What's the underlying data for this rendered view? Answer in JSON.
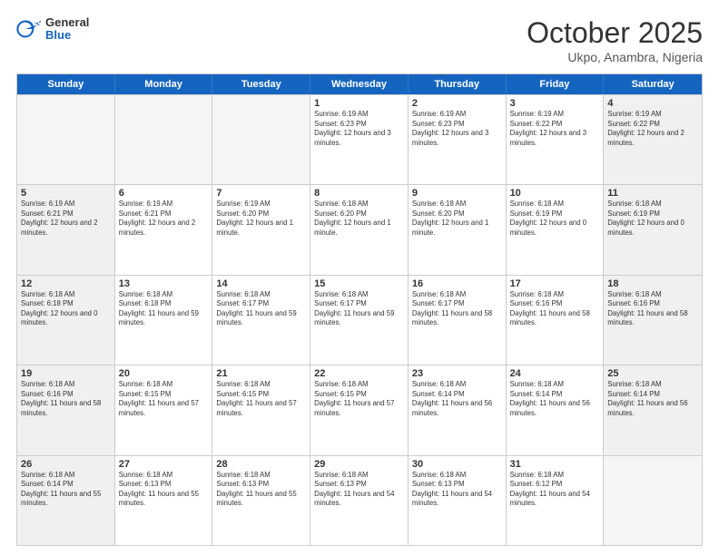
{
  "header": {
    "logo_general": "General",
    "logo_blue": "Blue",
    "month": "October 2025",
    "location": "Ukpo, Anambra, Nigeria"
  },
  "days_of_week": [
    "Sunday",
    "Monday",
    "Tuesday",
    "Wednesday",
    "Thursday",
    "Friday",
    "Saturday"
  ],
  "weeks": [
    [
      {
        "day": "",
        "empty": true
      },
      {
        "day": "",
        "empty": true
      },
      {
        "day": "",
        "empty": true
      },
      {
        "day": "1",
        "sunrise": "6:19 AM",
        "sunset": "6:23 PM",
        "daylight": "12 hours and 3 minutes."
      },
      {
        "day": "2",
        "sunrise": "6:19 AM",
        "sunset": "6:23 PM",
        "daylight": "12 hours and 3 minutes."
      },
      {
        "day": "3",
        "sunrise": "6:19 AM",
        "sunset": "6:22 PM",
        "daylight": "12 hours and 3 minutes."
      },
      {
        "day": "4",
        "sunrise": "6:19 AM",
        "sunset": "6:22 PM",
        "daylight": "12 hours and 2 minutes."
      }
    ],
    [
      {
        "day": "5",
        "sunrise": "6:19 AM",
        "sunset": "6:21 PM",
        "daylight": "12 hours and 2 minutes."
      },
      {
        "day": "6",
        "sunrise": "6:19 AM",
        "sunset": "6:21 PM",
        "daylight": "12 hours and 2 minutes."
      },
      {
        "day": "7",
        "sunrise": "6:19 AM",
        "sunset": "6:20 PM",
        "daylight": "12 hours and 1 minute."
      },
      {
        "day": "8",
        "sunrise": "6:18 AM",
        "sunset": "6:20 PM",
        "daylight": "12 hours and 1 minute."
      },
      {
        "day": "9",
        "sunrise": "6:18 AM",
        "sunset": "6:20 PM",
        "daylight": "12 hours and 1 minute."
      },
      {
        "day": "10",
        "sunrise": "6:18 AM",
        "sunset": "6:19 PM",
        "daylight": "12 hours and 0 minutes."
      },
      {
        "day": "11",
        "sunrise": "6:18 AM",
        "sunset": "6:19 PM",
        "daylight": "12 hours and 0 minutes."
      }
    ],
    [
      {
        "day": "12",
        "sunrise": "6:18 AM",
        "sunset": "6:18 PM",
        "daylight": "12 hours and 0 minutes."
      },
      {
        "day": "13",
        "sunrise": "6:18 AM",
        "sunset": "6:18 PM",
        "daylight": "11 hours and 59 minutes."
      },
      {
        "day": "14",
        "sunrise": "6:18 AM",
        "sunset": "6:17 PM",
        "daylight": "11 hours and 59 minutes."
      },
      {
        "day": "15",
        "sunrise": "6:18 AM",
        "sunset": "6:17 PM",
        "daylight": "11 hours and 59 minutes."
      },
      {
        "day": "16",
        "sunrise": "6:18 AM",
        "sunset": "6:17 PM",
        "daylight": "11 hours and 58 minutes."
      },
      {
        "day": "17",
        "sunrise": "6:18 AM",
        "sunset": "6:16 PM",
        "daylight": "11 hours and 58 minutes."
      },
      {
        "day": "18",
        "sunrise": "6:18 AM",
        "sunset": "6:16 PM",
        "daylight": "11 hours and 58 minutes."
      }
    ],
    [
      {
        "day": "19",
        "sunrise": "6:18 AM",
        "sunset": "6:16 PM",
        "daylight": "11 hours and 58 minutes."
      },
      {
        "day": "20",
        "sunrise": "6:18 AM",
        "sunset": "6:15 PM",
        "daylight": "11 hours and 57 minutes."
      },
      {
        "day": "21",
        "sunrise": "6:18 AM",
        "sunset": "6:15 PM",
        "daylight": "11 hours and 57 minutes."
      },
      {
        "day": "22",
        "sunrise": "6:18 AM",
        "sunset": "6:15 PM",
        "daylight": "11 hours and 57 minutes."
      },
      {
        "day": "23",
        "sunrise": "6:18 AM",
        "sunset": "6:14 PM",
        "daylight": "11 hours and 56 minutes."
      },
      {
        "day": "24",
        "sunrise": "6:18 AM",
        "sunset": "6:14 PM",
        "daylight": "11 hours and 56 minutes."
      },
      {
        "day": "25",
        "sunrise": "6:18 AM",
        "sunset": "6:14 PM",
        "daylight": "11 hours and 56 minutes."
      }
    ],
    [
      {
        "day": "26",
        "sunrise": "6:18 AM",
        "sunset": "6:14 PM",
        "daylight": "11 hours and 55 minutes."
      },
      {
        "day": "27",
        "sunrise": "6:18 AM",
        "sunset": "6:13 PM",
        "daylight": "11 hours and 55 minutes."
      },
      {
        "day": "28",
        "sunrise": "6:18 AM",
        "sunset": "6:13 PM",
        "daylight": "11 hours and 55 minutes."
      },
      {
        "day": "29",
        "sunrise": "6:18 AM",
        "sunset": "6:13 PM",
        "daylight": "11 hours and 54 minutes."
      },
      {
        "day": "30",
        "sunrise": "6:18 AM",
        "sunset": "6:13 PM",
        "daylight": "11 hours and 54 minutes."
      },
      {
        "day": "31",
        "sunrise": "6:18 AM",
        "sunset": "6:12 PM",
        "daylight": "11 hours and 54 minutes."
      },
      {
        "day": "",
        "empty": true
      }
    ]
  ]
}
